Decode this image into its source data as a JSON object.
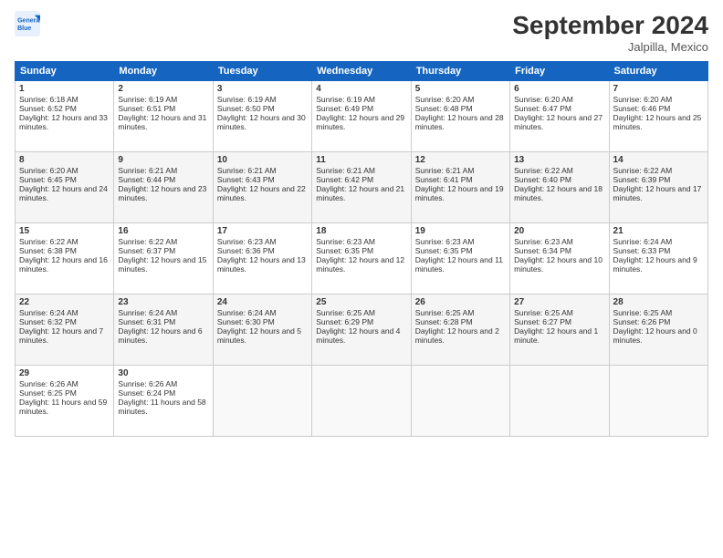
{
  "logo": {
    "line1": "General",
    "line2": "Blue"
  },
  "title": "September 2024",
  "subtitle": "Jalpilla, Mexico",
  "columns": [
    "Sunday",
    "Monday",
    "Tuesday",
    "Wednesday",
    "Thursday",
    "Friday",
    "Saturday"
  ],
  "weeks": [
    [
      {
        "day": "1",
        "sunrise": "Sunrise: 6:18 AM",
        "sunset": "Sunset: 6:52 PM",
        "daylight": "Daylight: 12 hours and 33 minutes."
      },
      {
        "day": "2",
        "sunrise": "Sunrise: 6:19 AM",
        "sunset": "Sunset: 6:51 PM",
        "daylight": "Daylight: 12 hours and 31 minutes."
      },
      {
        "day": "3",
        "sunrise": "Sunrise: 6:19 AM",
        "sunset": "Sunset: 6:50 PM",
        "daylight": "Daylight: 12 hours and 30 minutes."
      },
      {
        "day": "4",
        "sunrise": "Sunrise: 6:19 AM",
        "sunset": "Sunset: 6:49 PM",
        "daylight": "Daylight: 12 hours and 29 minutes."
      },
      {
        "day": "5",
        "sunrise": "Sunrise: 6:20 AM",
        "sunset": "Sunset: 6:48 PM",
        "daylight": "Daylight: 12 hours and 28 minutes."
      },
      {
        "day": "6",
        "sunrise": "Sunrise: 6:20 AM",
        "sunset": "Sunset: 6:47 PM",
        "daylight": "Daylight: 12 hours and 27 minutes."
      },
      {
        "day": "7",
        "sunrise": "Sunrise: 6:20 AM",
        "sunset": "Sunset: 6:46 PM",
        "daylight": "Daylight: 12 hours and 25 minutes."
      }
    ],
    [
      {
        "day": "8",
        "sunrise": "Sunrise: 6:20 AM",
        "sunset": "Sunset: 6:45 PM",
        "daylight": "Daylight: 12 hours and 24 minutes."
      },
      {
        "day": "9",
        "sunrise": "Sunrise: 6:21 AM",
        "sunset": "Sunset: 6:44 PM",
        "daylight": "Daylight: 12 hours and 23 minutes."
      },
      {
        "day": "10",
        "sunrise": "Sunrise: 6:21 AM",
        "sunset": "Sunset: 6:43 PM",
        "daylight": "Daylight: 12 hours and 22 minutes."
      },
      {
        "day": "11",
        "sunrise": "Sunrise: 6:21 AM",
        "sunset": "Sunset: 6:42 PM",
        "daylight": "Daylight: 12 hours and 21 minutes."
      },
      {
        "day": "12",
        "sunrise": "Sunrise: 6:21 AM",
        "sunset": "Sunset: 6:41 PM",
        "daylight": "Daylight: 12 hours and 19 minutes."
      },
      {
        "day": "13",
        "sunrise": "Sunrise: 6:22 AM",
        "sunset": "Sunset: 6:40 PM",
        "daylight": "Daylight: 12 hours and 18 minutes."
      },
      {
        "day": "14",
        "sunrise": "Sunrise: 6:22 AM",
        "sunset": "Sunset: 6:39 PM",
        "daylight": "Daylight: 12 hours and 17 minutes."
      }
    ],
    [
      {
        "day": "15",
        "sunrise": "Sunrise: 6:22 AM",
        "sunset": "Sunset: 6:38 PM",
        "daylight": "Daylight: 12 hours and 16 minutes."
      },
      {
        "day": "16",
        "sunrise": "Sunrise: 6:22 AM",
        "sunset": "Sunset: 6:37 PM",
        "daylight": "Daylight: 12 hours and 15 minutes."
      },
      {
        "day": "17",
        "sunrise": "Sunrise: 6:23 AM",
        "sunset": "Sunset: 6:36 PM",
        "daylight": "Daylight: 12 hours and 13 minutes."
      },
      {
        "day": "18",
        "sunrise": "Sunrise: 6:23 AM",
        "sunset": "Sunset: 6:35 PM",
        "daylight": "Daylight: 12 hours and 12 minutes."
      },
      {
        "day": "19",
        "sunrise": "Sunrise: 6:23 AM",
        "sunset": "Sunset: 6:35 PM",
        "daylight": "Daylight: 12 hours and 11 minutes."
      },
      {
        "day": "20",
        "sunrise": "Sunrise: 6:23 AM",
        "sunset": "Sunset: 6:34 PM",
        "daylight": "Daylight: 12 hours and 10 minutes."
      },
      {
        "day": "21",
        "sunrise": "Sunrise: 6:24 AM",
        "sunset": "Sunset: 6:33 PM",
        "daylight": "Daylight: 12 hours and 9 minutes."
      }
    ],
    [
      {
        "day": "22",
        "sunrise": "Sunrise: 6:24 AM",
        "sunset": "Sunset: 6:32 PM",
        "daylight": "Daylight: 12 hours and 7 minutes."
      },
      {
        "day": "23",
        "sunrise": "Sunrise: 6:24 AM",
        "sunset": "Sunset: 6:31 PM",
        "daylight": "Daylight: 12 hours and 6 minutes."
      },
      {
        "day": "24",
        "sunrise": "Sunrise: 6:24 AM",
        "sunset": "Sunset: 6:30 PM",
        "daylight": "Daylight: 12 hours and 5 minutes."
      },
      {
        "day": "25",
        "sunrise": "Sunrise: 6:25 AM",
        "sunset": "Sunset: 6:29 PM",
        "daylight": "Daylight: 12 hours and 4 minutes."
      },
      {
        "day": "26",
        "sunrise": "Sunrise: 6:25 AM",
        "sunset": "Sunset: 6:28 PM",
        "daylight": "Daylight: 12 hours and 2 minutes."
      },
      {
        "day": "27",
        "sunrise": "Sunrise: 6:25 AM",
        "sunset": "Sunset: 6:27 PM",
        "daylight": "Daylight: 12 hours and 1 minute."
      },
      {
        "day": "28",
        "sunrise": "Sunrise: 6:25 AM",
        "sunset": "Sunset: 6:26 PM",
        "daylight": "Daylight: 12 hours and 0 minutes."
      }
    ],
    [
      {
        "day": "29",
        "sunrise": "Sunrise: 6:26 AM",
        "sunset": "Sunset: 6:25 PM",
        "daylight": "Daylight: 11 hours and 59 minutes."
      },
      {
        "day": "30",
        "sunrise": "Sunrise: 6:26 AM",
        "sunset": "Sunset: 6:24 PM",
        "daylight": "Daylight: 11 hours and 58 minutes."
      },
      null,
      null,
      null,
      null,
      null
    ]
  ]
}
